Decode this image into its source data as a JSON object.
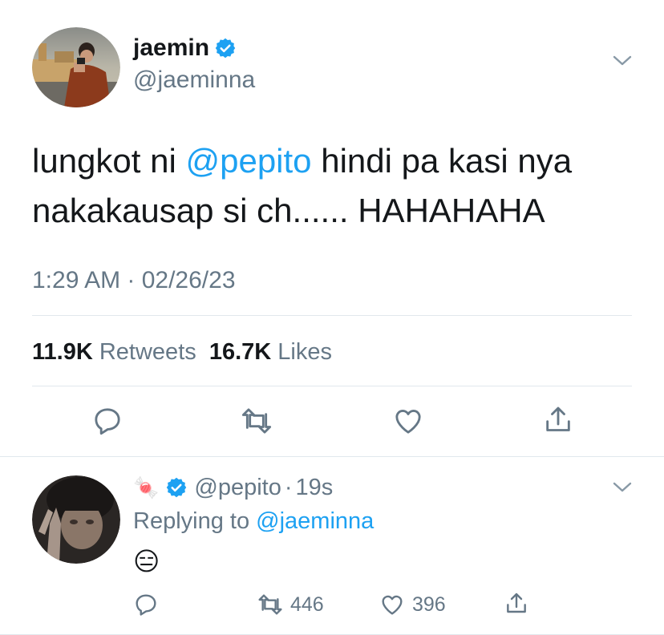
{
  "colors": {
    "text": "#14171a",
    "muted": "#657786",
    "link": "#1da1f2",
    "verified": "#1da1f2",
    "divider": "#e1e8ed"
  },
  "tweet": {
    "author": {
      "name": "jaemin",
      "handle": "@jaeminna",
      "verified": true,
      "avatar_icon": "profile-photo"
    },
    "text_before": "lungkot ni ",
    "mention": "@pepito",
    "text_after": " hindi pa kasi nya",
    "text_line2": "nakakausap si ch...... HAHAHAHA",
    "timestamp": "1:29 AM · 02/26/23",
    "stats": {
      "retweets_count": "11.9K",
      "retweets_label": "Retweets",
      "likes_count": "16.7K",
      "likes_label": "Likes"
    },
    "actions": [
      "reply-icon",
      "retweet-icon",
      "like-icon",
      "share-icon"
    ]
  },
  "reply": {
    "author": {
      "name_emoji": "🍬",
      "verified": true,
      "handle": "@pepito",
      "separator": "·",
      "time": "19s",
      "avatar_icon": "profile-photo"
    },
    "replying_prefix": "Replying to",
    "replying_handle": "@jaeminna",
    "body_emoji": "😑",
    "stats": {
      "retweets": "446",
      "likes": "396"
    }
  }
}
